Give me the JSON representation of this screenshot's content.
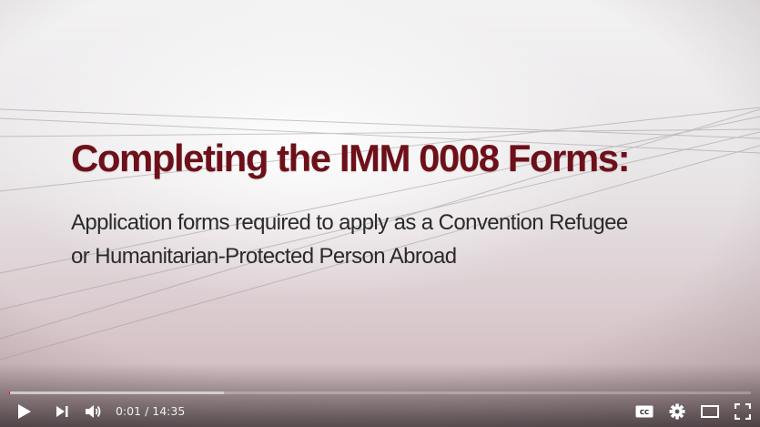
{
  "video": {
    "title": "Completing the IMM 0008 Forms:",
    "subtitle_lines": [
      "Application forms required to apply as a Convention Refugee",
      "or Humanitarian-Protected Person Abroad"
    ]
  },
  "player": {
    "current_time": "0:01",
    "separator": "/",
    "duration": "14:35",
    "played_fraction": 0.001,
    "loaded_fraction": 0.29,
    "colors": {
      "progress_played": "#ff0000",
      "title": "#6e1019"
    },
    "icons": [
      "play-icon",
      "next-icon",
      "volume-icon",
      "captions-icon",
      "settings-icon",
      "theater-mode-icon",
      "fullscreen-icon"
    ]
  }
}
